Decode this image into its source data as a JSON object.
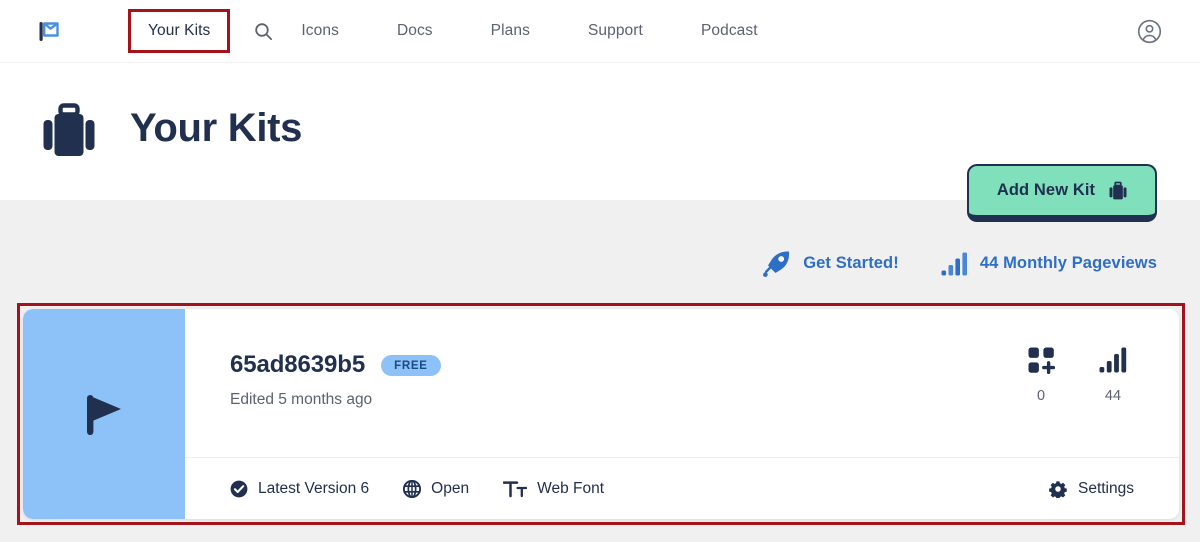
{
  "nav": {
    "logo_icon": "flag-icon",
    "items": [
      {
        "label": "Your Kits",
        "icon": "",
        "active": true
      },
      {
        "label": "",
        "icon": "search-icon",
        "active": false
      },
      {
        "label": "Icons",
        "icon": "",
        "active": false
      },
      {
        "label": "Docs",
        "icon": "",
        "active": false
      },
      {
        "label": "Plans",
        "icon": "",
        "active": false
      },
      {
        "label": "Support",
        "icon": "",
        "active": false
      },
      {
        "label": "Podcast",
        "icon": "",
        "active": false
      }
    ],
    "account_icon": "user-circle-icon"
  },
  "header": {
    "icon": "briefcase-icon",
    "title": "Your Kits",
    "add_button": {
      "label": "Add New Kit",
      "icon": "briefcase-icon",
      "bg_color": "#7fe0bb",
      "border_color": "#21304e"
    }
  },
  "stats": [
    {
      "icon": "rocket-icon",
      "label": "Get Started!",
      "color": "#2d6ec7"
    },
    {
      "icon": "chart-bar-icon",
      "label": "44 Monthly Pageviews",
      "color": "#2d6ec7"
    }
  ],
  "kit": {
    "thumbnail": {
      "icon": "flag-icon",
      "bg_color": "#8cc2f7",
      "icon_color": "#21304e"
    },
    "name": "65ad8639b5",
    "badge": "FREE",
    "edited": "Edited 5 months ago",
    "metrics": [
      {
        "icon": "icons-grid-plus-icon",
        "value": "0"
      },
      {
        "icon": "chart-bar-icon",
        "value": "44"
      }
    ],
    "actions": [
      {
        "icon": "check-circle-icon",
        "label": "Latest Version 6"
      },
      {
        "icon": "globe-icon",
        "label": "Open"
      },
      {
        "icon": "web-font-icon",
        "label": "Web Font"
      }
    ],
    "settings": {
      "icon": "gear-icon",
      "label": "Settings"
    }
  },
  "annotations": {
    "highlight_color": "#a4131b"
  }
}
